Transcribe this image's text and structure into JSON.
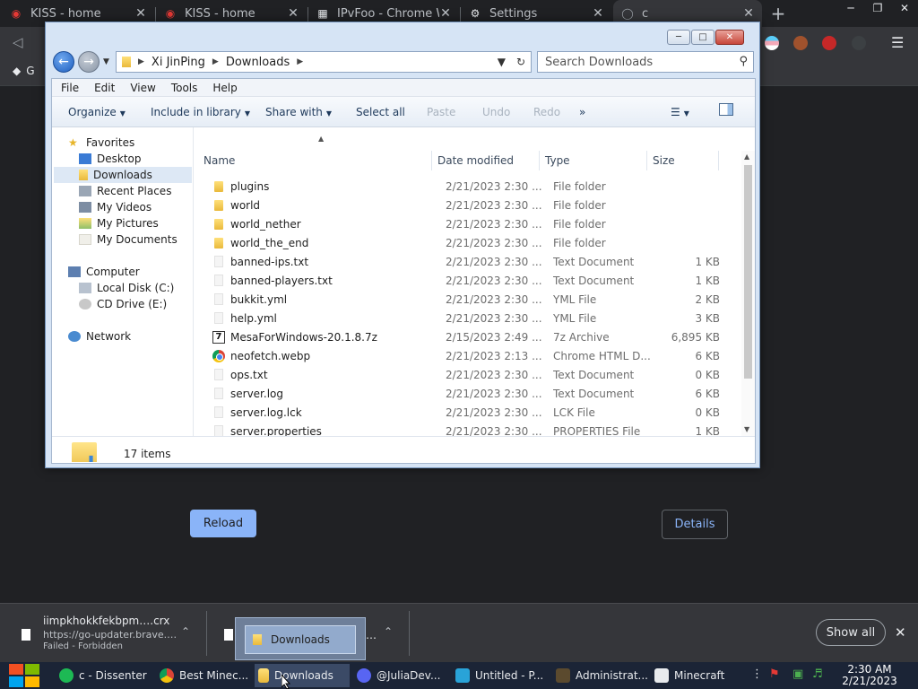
{
  "browser": {
    "tabs": [
      {
        "label": "KISS - home"
      },
      {
        "label": "KISS - home"
      },
      {
        "label": "IPvFoo - Chrome W"
      },
      {
        "label": "Settings"
      },
      {
        "label": "c"
      }
    ],
    "bookmark_label": "G"
  },
  "error_page": {
    "reload_label": "Reload",
    "details_label": "Details"
  },
  "explorer": {
    "breadcrumb": [
      "Xi JinPing",
      "Downloads"
    ],
    "search_placeholder": "Search Downloads",
    "menu": [
      "File",
      "Edit",
      "View",
      "Tools",
      "Help"
    ],
    "commands": {
      "organize": "Organize",
      "include": "Include in library",
      "share": "Share with",
      "select_all": "Select all",
      "paste": "Paste",
      "undo": "Undo",
      "redo": "Redo",
      "more": "»"
    },
    "nav": {
      "favorites": "Favorites",
      "desktop": "Desktop",
      "downloads": "Downloads",
      "recent": "Recent Places",
      "videos": "My Videos",
      "pictures": "My Pictures",
      "documents": "My Documents",
      "computer": "Computer",
      "local_disk": "Local Disk (C:)",
      "cd_drive": "CD Drive (E:)",
      "network": "Network"
    },
    "columns": {
      "name": "Name",
      "date": "Date modified",
      "type": "Type",
      "size": "Size"
    },
    "files": [
      {
        "name": "plugins",
        "date": "2/21/2023 2:30 ...",
        "type": "File folder",
        "size": "",
        "icon": "folder-icon"
      },
      {
        "name": "world",
        "date": "2/21/2023 2:30 ...",
        "type": "File folder",
        "size": "",
        "icon": "folder-icon"
      },
      {
        "name": "world_nether",
        "date": "2/21/2023 2:30 ...",
        "type": "File folder",
        "size": "",
        "icon": "folder-icon"
      },
      {
        "name": "world_the_end",
        "date": "2/21/2023 2:30 ...",
        "type": "File folder",
        "size": "",
        "icon": "folder-icon"
      },
      {
        "name": "banned-ips.txt",
        "date": "2/21/2023 2:30 ...",
        "type": "Text Document",
        "size": "1 KB",
        "icon": "document-icon"
      },
      {
        "name": "banned-players.txt",
        "date": "2/21/2023 2:30 ...",
        "type": "Text Document",
        "size": "1 KB",
        "icon": "document-icon"
      },
      {
        "name": "bukkit.yml",
        "date": "2/21/2023 2:30 ...",
        "type": "YML File",
        "size": "2 KB",
        "icon": "document-icon"
      },
      {
        "name": "help.yml",
        "date": "2/21/2023 2:30 ...",
        "type": "YML File",
        "size": "3 KB",
        "icon": "document-icon"
      },
      {
        "name": "MesaForWindows-20.1.8.7z",
        "date": "2/15/2023 2:49 ...",
        "type": "7z Archive",
        "size": "6,895 KB",
        "icon": "archive-icon"
      },
      {
        "name": "neofetch.webp",
        "date": "2/21/2023 2:13 ...",
        "type": "Chrome HTML D...",
        "size": "6 KB",
        "icon": "chrome-icon"
      },
      {
        "name": "ops.txt",
        "date": "2/21/2023 2:30 ...",
        "type": "Text Document",
        "size": "0 KB",
        "icon": "document-icon"
      },
      {
        "name": "server.log",
        "date": "2/21/2023 2:30 ...",
        "type": "Text Document",
        "size": "6 KB",
        "icon": "document-icon"
      },
      {
        "name": "server.log.lck",
        "date": "2/21/2023 2:30 ...",
        "type": "LCK File",
        "size": "0 KB",
        "icon": "document-icon"
      },
      {
        "name": "server.properties",
        "date": "2/21/2023 2:30 ...",
        "type": "PROPERTIES File",
        "size": "1 KB",
        "icon": "document-icon"
      }
    ],
    "item_count": "17 items"
  },
  "downloads_bar": {
    "item1": {
      "name": "iimpkhokkfekbpm….crx",
      "url": "https://go-updater.brave.…",
      "status": "Failed - Forbidden"
    },
    "item2": {
      "name": "…"
    },
    "thumbnail_label": "Downloads",
    "show_all": "Show all"
  },
  "taskbar": {
    "tasks": [
      {
        "label": "c - Dissenter"
      },
      {
        "label": "Best Minec..."
      },
      {
        "label": "Downloads"
      },
      {
        "label": "@JuliaDev..."
      },
      {
        "label": "Untitled - P..."
      },
      {
        "label": "Administrat..."
      },
      {
        "label": "Minecraft"
      }
    ],
    "time": "2:30 AM",
    "date": "2/21/2023"
  },
  "colors": {
    "browser_bg": "#202124",
    "accent_blue": "#8ab4f8",
    "taskbar": "#1b2436",
    "explorer_frame": "#d6e4f5"
  }
}
